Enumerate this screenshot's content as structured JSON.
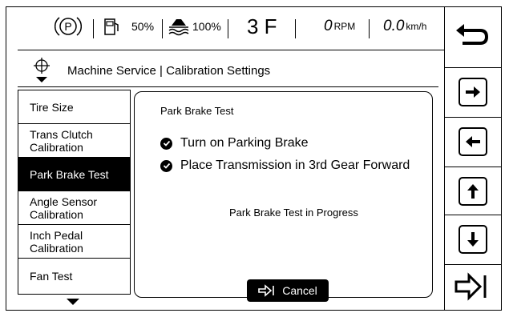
{
  "status_bar": {
    "park_symbol": "P",
    "fuel_level": "50%",
    "def_level": "100%",
    "gear": "3 F",
    "rpm_value": "0",
    "rpm_unit": "RPM",
    "speed_value": "0.0",
    "speed_unit": "km/h"
  },
  "header": {
    "title": "Machine Service | Calibration Settings"
  },
  "menu": {
    "items": [
      {
        "label": "Tire Size"
      },
      {
        "label": "Trans Clutch Calibration"
      },
      {
        "label": "Park Brake Test"
      },
      {
        "label": "Angle Sensor Calibration"
      },
      {
        "label": "Inch Pedal Calibration"
      },
      {
        "label": "Fan Test"
      }
    ],
    "active_index": 2
  },
  "content": {
    "title": "Park Brake Test",
    "steps": [
      {
        "label": "Turn on Parking Brake"
      },
      {
        "label": "Place Transmission in 3rd Gear Forward"
      }
    ],
    "progress_text": "Park Brake Test in Progress",
    "cancel_label": "Cancel"
  },
  "right_buttons": [
    "back-icon",
    "arrow-right-icon",
    "arrow-left-icon",
    "arrow-up-icon",
    "arrow-down-icon",
    "enter-icon"
  ]
}
